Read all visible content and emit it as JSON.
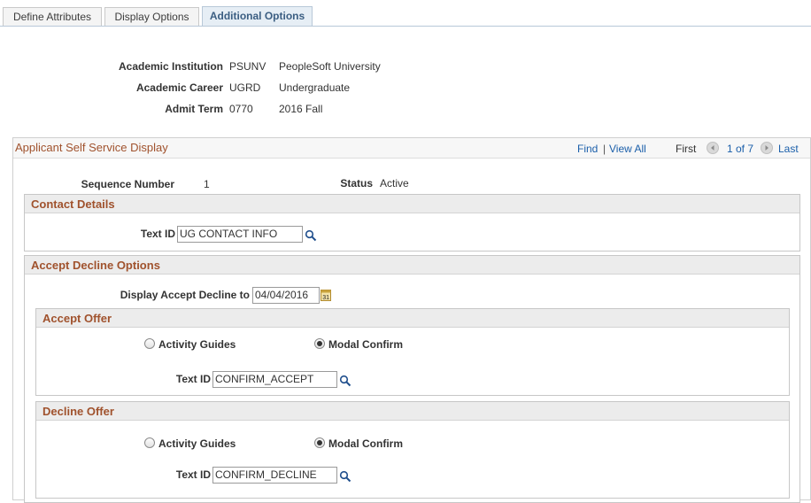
{
  "tabs": [
    {
      "label": "Define Attributes"
    },
    {
      "label": "Display Options"
    },
    {
      "label": "Additional Options"
    }
  ],
  "header": {
    "institution_label": "Academic Institution",
    "institution_code": "PSUNV",
    "institution_name": "PeopleSoft University",
    "career_label": "Academic Career",
    "career_code": "UGRD",
    "career_name": "Undergraduate",
    "term_label": "Admit Term",
    "term_code": "0770",
    "term_name": "2016 Fall"
  },
  "grid": {
    "title": "Applicant Self Service Display",
    "find": "Find",
    "sep": "|",
    "view_all": "View All",
    "first": "First",
    "position": "1 of 7",
    "last": "Last"
  },
  "row": {
    "seq_label": "Sequence Number",
    "seq_value": "1",
    "status_label": "Status",
    "status_value": "Active"
  },
  "contact": {
    "title": "Contact Details",
    "text_id_label": "Text ID",
    "text_id_value": "UG CONTACT INFO"
  },
  "accept_decline": {
    "title": "Accept Decline Options",
    "display_label": "Display Accept Decline to",
    "display_value": "04/04/2016"
  },
  "accept_offer": {
    "title": "Accept Offer",
    "opt1": "Activity Guides",
    "opt2": "Modal Confirm",
    "text_id_label": "Text ID",
    "text_id_value": "CONFIRM_ACCEPT"
  },
  "decline_offer": {
    "title": "Decline Offer",
    "opt1": "Activity Guides",
    "opt2": "Modal Confirm",
    "text_id_label": "Text ID",
    "text_id_value": "CONFIRM_DECLINE"
  },
  "icons": {
    "lookup": "magnifier-icon",
    "calendar": "calendar-icon",
    "prev": "left-arrow-icon",
    "next": "right-arrow-icon"
  }
}
